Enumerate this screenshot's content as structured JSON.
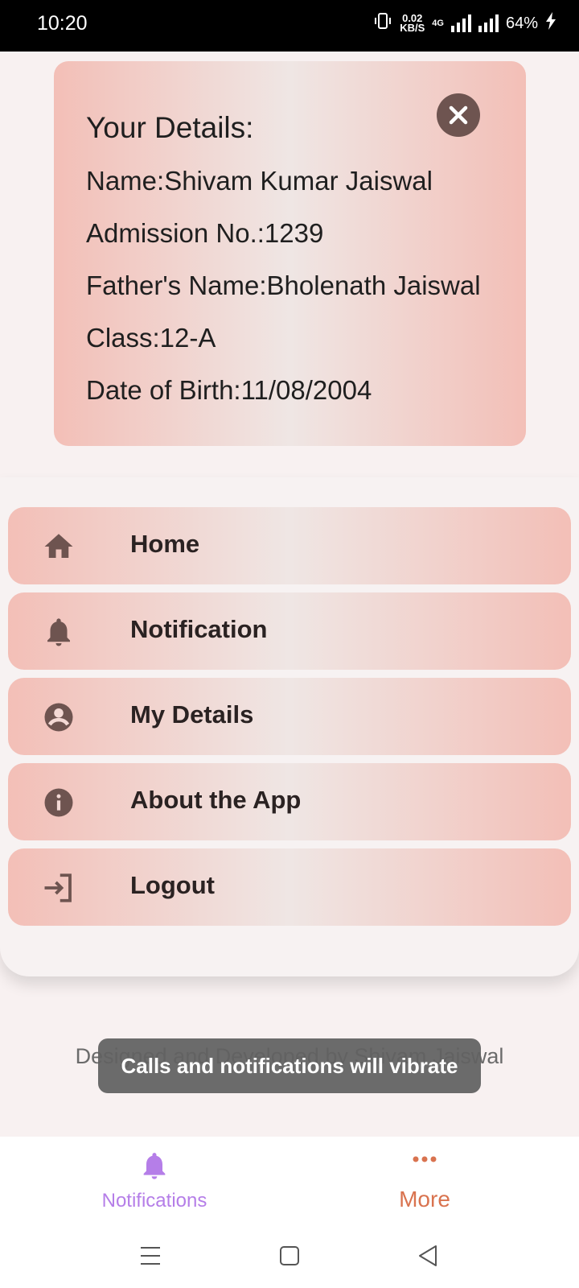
{
  "status_bar": {
    "time": "10:20",
    "data_rate_value": "0.02",
    "data_rate_unit": "KB/S",
    "network": "4G",
    "battery": "64%"
  },
  "details_card": {
    "heading": "Your Details:",
    "name": "Name:Shivam Kumar Jaiswal",
    "admission": "Admission No.:1239",
    "father": "Father's Name:Bholenath Jaiswal",
    "class": "Class:12-A",
    "dob": "Date of Birth:11/08/2004",
    "close_icon": "close-icon"
  },
  "menu": {
    "items": [
      {
        "label": "Home",
        "icon": "home-icon"
      },
      {
        "label": "Notification",
        "icon": "bell-icon"
      },
      {
        "label": "My Details",
        "icon": "account-circle-icon"
      },
      {
        "label": "About the App",
        "icon": "info-icon"
      },
      {
        "label": "Logout",
        "icon": "login-icon"
      }
    ]
  },
  "footer": {
    "credit": "Designed and Developed by Shivam Jaiswal"
  },
  "toast": {
    "message": "Calls and notifications will vibrate"
  },
  "bottom_nav": {
    "notifications_label": "Notifications",
    "more_label": "More"
  },
  "colors": {
    "card_gradient_edge": "#f3bfb7",
    "card_gradient_center": "#efe6e4",
    "icon_brown": "#6e5450",
    "notifications_purple": "#b57ee8",
    "more_orange": "#d9734f"
  }
}
